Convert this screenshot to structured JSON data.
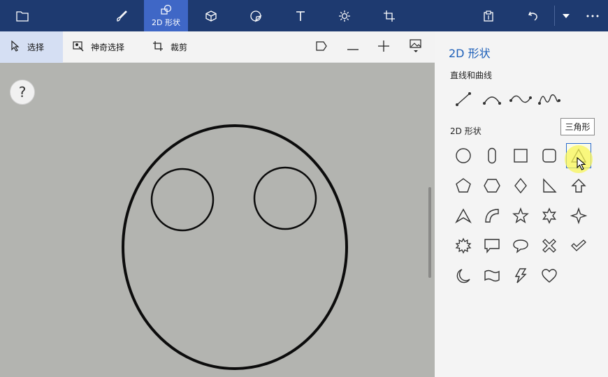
{
  "topbar": {
    "active_tab_label": "2D 形状",
    "tabs": [
      "folder-icon",
      "brush-icon",
      "2d-shapes-icon",
      "3d-cube-icon",
      "sticker-icon",
      "text-icon",
      "effects-icon",
      "canvas-crop-icon"
    ],
    "right_icons": [
      "paste-3d-icon",
      "undo-icon",
      "dropdown-icon",
      "more-icon"
    ]
  },
  "toolbar": {
    "select_label": "选择",
    "magic_select_label": "神奇选择",
    "crop_label": "裁剪",
    "right_icons": [
      "flag-icon",
      "zoom-out-icon",
      "zoom-in-icon",
      "image-view-icon"
    ]
  },
  "canvas": {
    "help_label": "?"
  },
  "panel": {
    "title": "2D 形状",
    "lines_heading": "直线和曲线",
    "shapes_heading": "2D 形状",
    "tooltip": "三角形",
    "selected_shape": "triangle-icon"
  },
  "colors": {
    "topbar": "#1e3a70",
    "topbar_active": "#3f67c6",
    "accent": "#1d5fb8",
    "canvas_bg": "#b3b4b0",
    "panel_bg": "#f4f4f4"
  }
}
